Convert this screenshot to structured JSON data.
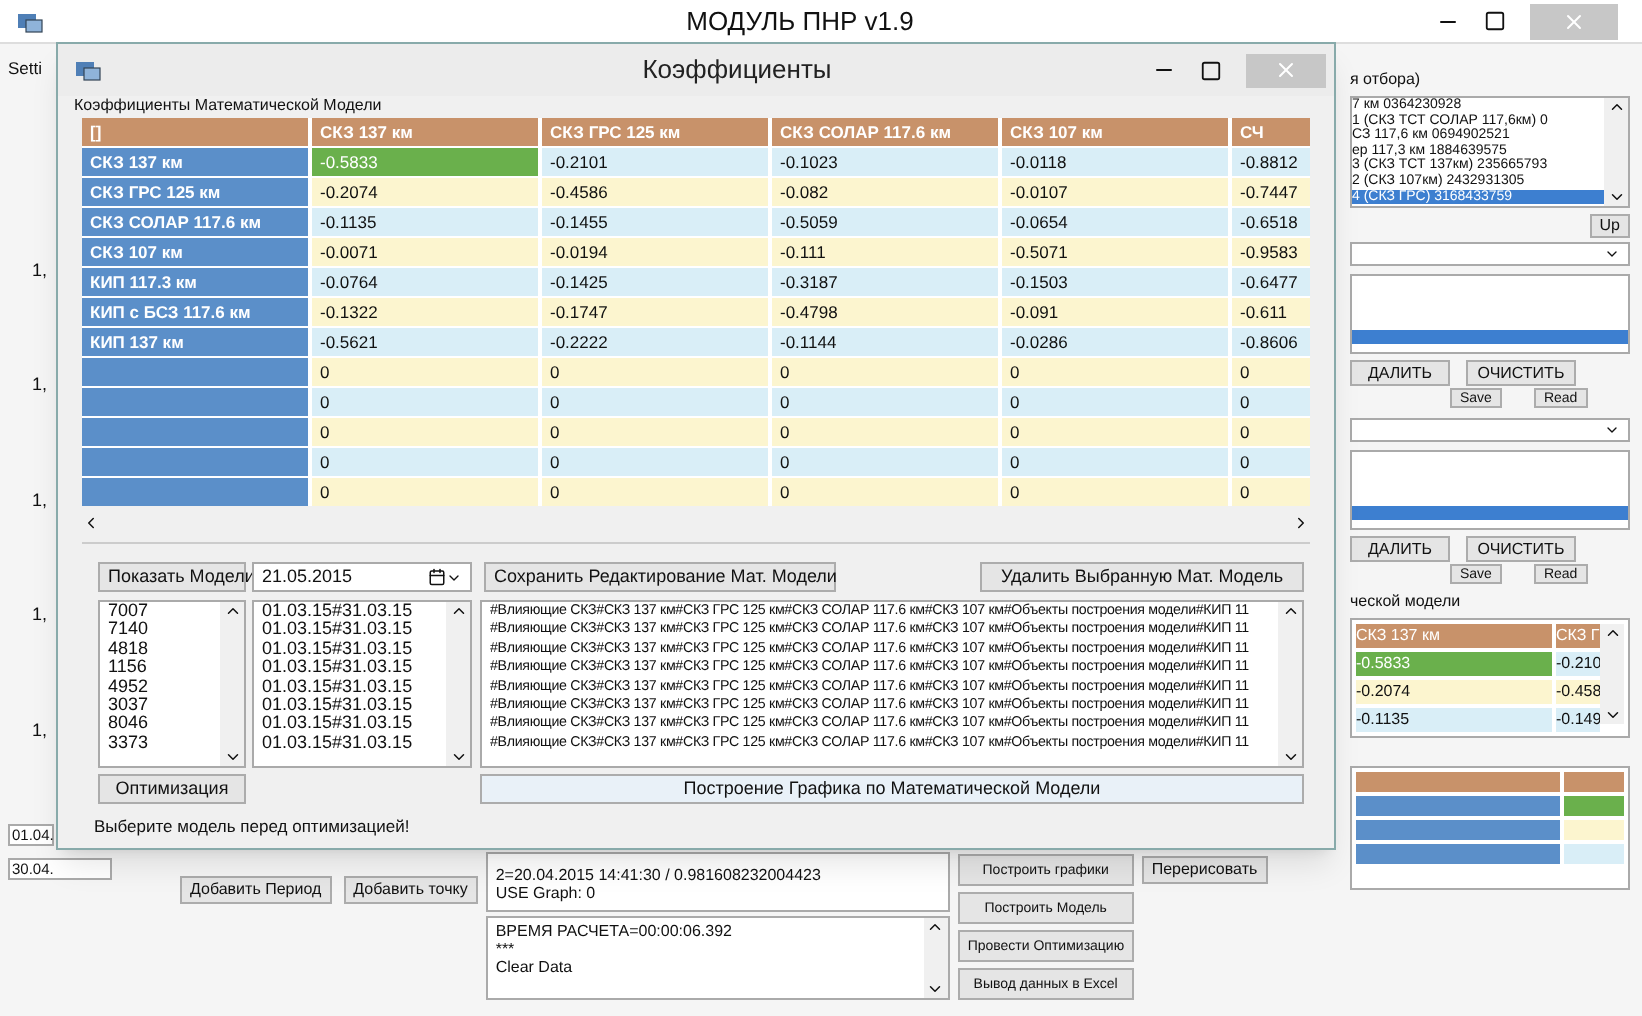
{
  "main_window": {
    "title": "МОДУЛЬ ПНР v1.9",
    "tab": "Setti",
    "row_stubs": [
      "1,",
      "1,",
      "1,",
      "1,",
      "1,"
    ],
    "filter_label": "я отбора)",
    "filter_items": [
      {
        "text": "7 км 0364230928",
        "selected": false
      },
      {
        "text": "1 (СКЗ ТСТ СОЛАР 117,6км) 0",
        "selected": false
      },
      {
        "text": "СЗ 117,6 км 0694902521",
        "selected": false
      },
      {
        "text": "ер 117,3 км 1884639575",
        "selected": false
      },
      {
        "text": "3 (СКЗ ТСТ 137км) 235665793",
        "selected": false
      },
      {
        "text": "2 (СКЗ 107км) 2432931305",
        "selected": false
      },
      {
        "text": "4 (СКЗ ГРС) 3168433759",
        "selected": true
      }
    ],
    "up_button": "Up",
    "list_panels": [
      {
        "delete": "ДАЛИТЬ",
        "clear": "ОЧИСТИТЬ",
        "save": "Save",
        "read": "Read"
      },
      {
        "delete": "ДАЛИТЬ",
        "clear": "ОЧИСТИТЬ",
        "save": "Save",
        "read": "Read"
      }
    ],
    "model_label": "ческой модели",
    "mini_table": {
      "columns": [
        "СКЗ 137 км",
        "СКЗ Г"
      ],
      "rows": [
        {
          "cells": [
            {
              "text": "-0.5833",
              "selected": true
            },
            {
              "text": "-0.210",
              "selected": false
            }
          ]
        },
        {
          "cells": [
            {
              "text": "-0.2074",
              "selected": false
            },
            {
              "text": "-0.458",
              "selected": false
            }
          ]
        },
        {
          "cells": [
            {
              "text": "-0.1135",
              "selected": false
            },
            {
              "text": "-0.149",
              "selected": false
            }
          ]
        }
      ]
    },
    "dates": [
      "01.04.",
      "30.04."
    ],
    "add_period": "Добавить Период",
    "add_point": "Добавить точку",
    "log_top": [
      "2=20.04.2015 14:41:30 / 0.981608232004423",
      "USE Graph: 0"
    ],
    "log_bottom": [
      "ВРЕМЯ РАСЧЕТА=00:00:06.392",
      "***",
      "Clear Data"
    ],
    "actions": [
      "Построить графики",
      "Построить Модель",
      "Провести Оптимизацию",
      "Вывод данных в Excel"
    ],
    "redraw": "Перерисовать"
  },
  "dialog": {
    "title": "Коэффициенты",
    "group_label": "Коэффициенты Математической Модели",
    "table": {
      "corner": "[]",
      "columns": [
        "СКЗ 137 км",
        "СКЗ ГРС 125 км",
        "СКЗ СОЛАР 117.6 км",
        "СКЗ 107 км",
        "СЧ"
      ],
      "rows": [
        {
          "header": "СКЗ 137 км",
          "cells": [
            {
              "text": "-0.5833",
              "selected": true
            },
            {
              "text": "-0.2101",
              "selected": false
            },
            {
              "text": "-0.1023",
              "selected": false
            },
            {
              "text": "-0.0118",
              "selected": false
            },
            {
              "text": "-0.8812",
              "selected": false
            }
          ]
        },
        {
          "header": "СКЗ ГРС 125 км",
          "cells": [
            {
              "text": "-0.2074",
              "selected": false
            },
            {
              "text": "-0.4586",
              "selected": false
            },
            {
              "text": "-0.082",
              "selected": false
            },
            {
              "text": "-0.0107",
              "selected": false
            },
            {
              "text": "-0.7447",
              "selected": false
            }
          ]
        },
        {
          "header": "СКЗ СОЛАР 117.6 км",
          "cells": [
            {
              "text": "-0.1135",
              "selected": false
            },
            {
              "text": "-0.1455",
              "selected": false
            },
            {
              "text": "-0.5059",
              "selected": false
            },
            {
              "text": "-0.0654",
              "selected": false
            },
            {
              "text": "-0.6518",
              "selected": false
            }
          ]
        },
        {
          "header": "СКЗ 107 км",
          "cells": [
            {
              "text": "-0.0071",
              "selected": false
            },
            {
              "text": "-0.0194",
              "selected": false
            },
            {
              "text": "-0.111",
              "selected": false
            },
            {
              "text": "-0.5071",
              "selected": false
            },
            {
              "text": "-0.9583",
              "selected": false
            }
          ]
        },
        {
          "header": "КИП 117.3 км",
          "cells": [
            {
              "text": "-0.0764",
              "selected": false
            },
            {
              "text": "-0.1425",
              "selected": false
            },
            {
              "text": "-0.3187",
              "selected": false
            },
            {
              "text": "-0.1503",
              "selected": false
            },
            {
              "text": "-0.6477",
              "selected": false
            }
          ]
        },
        {
          "header": "КИП с БСЗ 117.6 км",
          "cells": [
            {
              "text": "-0.1322",
              "selected": false
            },
            {
              "text": "-0.1747",
              "selected": false
            },
            {
              "text": "-0.4798",
              "selected": false
            },
            {
              "text": "-0.091",
              "selected": false
            },
            {
              "text": "-0.611",
              "selected": false
            }
          ]
        },
        {
          "header": "КИП 137 км",
          "cells": [
            {
              "text": "-0.5621",
              "selected": false
            },
            {
              "text": "-0.2222",
              "selected": false
            },
            {
              "text": "-0.1144",
              "selected": false
            },
            {
              "text": "-0.0286",
              "selected": false
            },
            {
              "text": "-0.8606",
              "selected": false
            }
          ]
        },
        {
          "header": "",
          "cells": [
            {
              "text": "0",
              "selected": false
            },
            {
              "text": "0",
              "selected": false
            },
            {
              "text": "0",
              "selected": false
            },
            {
              "text": "0",
              "selected": false
            },
            {
              "text": "0",
              "selected": false
            }
          ]
        },
        {
          "header": "",
          "cells": [
            {
              "text": "0",
              "selected": false
            },
            {
              "text": "0",
              "selected": false
            },
            {
              "text": "0",
              "selected": false
            },
            {
              "text": "0",
              "selected": false
            },
            {
              "text": "0",
              "selected": false
            }
          ]
        },
        {
          "header": "",
          "cells": [
            {
              "text": "0",
              "selected": false
            },
            {
              "text": "0",
              "selected": false
            },
            {
              "text": "0",
              "selected": false
            },
            {
              "text": "0",
              "selected": false
            },
            {
              "text": "0",
              "selected": false
            }
          ]
        },
        {
          "header": "",
          "cells": [
            {
              "text": "0",
              "selected": false
            },
            {
              "text": "0",
              "selected": false
            },
            {
              "text": "0",
              "selected": false
            },
            {
              "text": "0",
              "selected": false
            },
            {
              "text": "0",
              "selected": false
            }
          ]
        },
        {
          "header": "",
          "cells": [
            {
              "text": "0",
              "selected": false
            },
            {
              "text": "0",
              "selected": false
            },
            {
              "text": "0",
              "selected": false
            },
            {
              "text": "0",
              "selected": false
            },
            {
              "text": "0",
              "selected": false
            }
          ]
        }
      ]
    },
    "show_models": "Показать Модели",
    "date": "21.05.2015",
    "save_edit": "Сохранить Редактирование Мат. Модели",
    "delete_model": "Удалить Выбранную Мат. Модель",
    "model_ids": [
      "7007",
      "7140",
      "4818",
      "1156",
      "4952",
      "3037",
      "8046",
      "3373"
    ],
    "periods": [
      "01.03.15#31.03.15",
      "01.03.15#31.03.15",
      "01.03.15#31.03.15",
      "01.03.15#31.03.15",
      "01.03.15#31.03.15",
      "01.03.15#31.03.15",
      "01.03.15#31.03.15",
      "01.03.15#31.03.15"
    ],
    "descriptions": [
      "#Влияющие СКЗ#СКЗ 137 км#СКЗ ГРС 125 км#СКЗ СОЛАР 117.6 км#СКЗ 107 км#Объекты построения модели#КИП 11",
      "#Влияющие СКЗ#СКЗ 137 км#СКЗ ГРС 125 км#СКЗ СОЛАР 117.6 км#СКЗ 107 км#Объекты построения модели#КИП 11",
      "#Влияющие СКЗ#СКЗ 137 км#СКЗ ГРС 125 км#СКЗ СОЛАР 117.6 км#СКЗ 107 км#Объекты построения модели#КИП 11",
      "#Влияющие СКЗ#СКЗ 137 км#СКЗ ГРС 125 км#СКЗ СОЛАР 117.6 км#СКЗ 107 км#Объекты построения модели#КИП 11",
      "#Влияющие СКЗ#СКЗ 137 км#СКЗ ГРС 125 км#СКЗ СОЛАР 117.6 км#СКЗ 107 км#Объекты построения модели#КИП 11",
      "#Влияющие СКЗ#СКЗ 137 км#СКЗ ГРС 125 км#СКЗ СОЛАР 117.6 км#СКЗ 107 км#Объекты построения модели#КИП 11",
      "#Влияющие СКЗ#СКЗ 137 км#СКЗ ГРС 125 км#СКЗ СОЛАР 117.6 км#СКЗ 107 км#Объекты построения модели#КИП 11",
      "#Влияющие СКЗ#СКЗ 137 км#СКЗ ГРС 125 км#СКЗ СОЛАР 117.6 км#СКЗ 107 км#Объекты построения модели#КИП 11"
    ],
    "optimize": "Оптимизация",
    "build_chart": "Построение Графика по Математической Модели",
    "hint": "Выберите модель перед оптимизацией!"
  }
}
